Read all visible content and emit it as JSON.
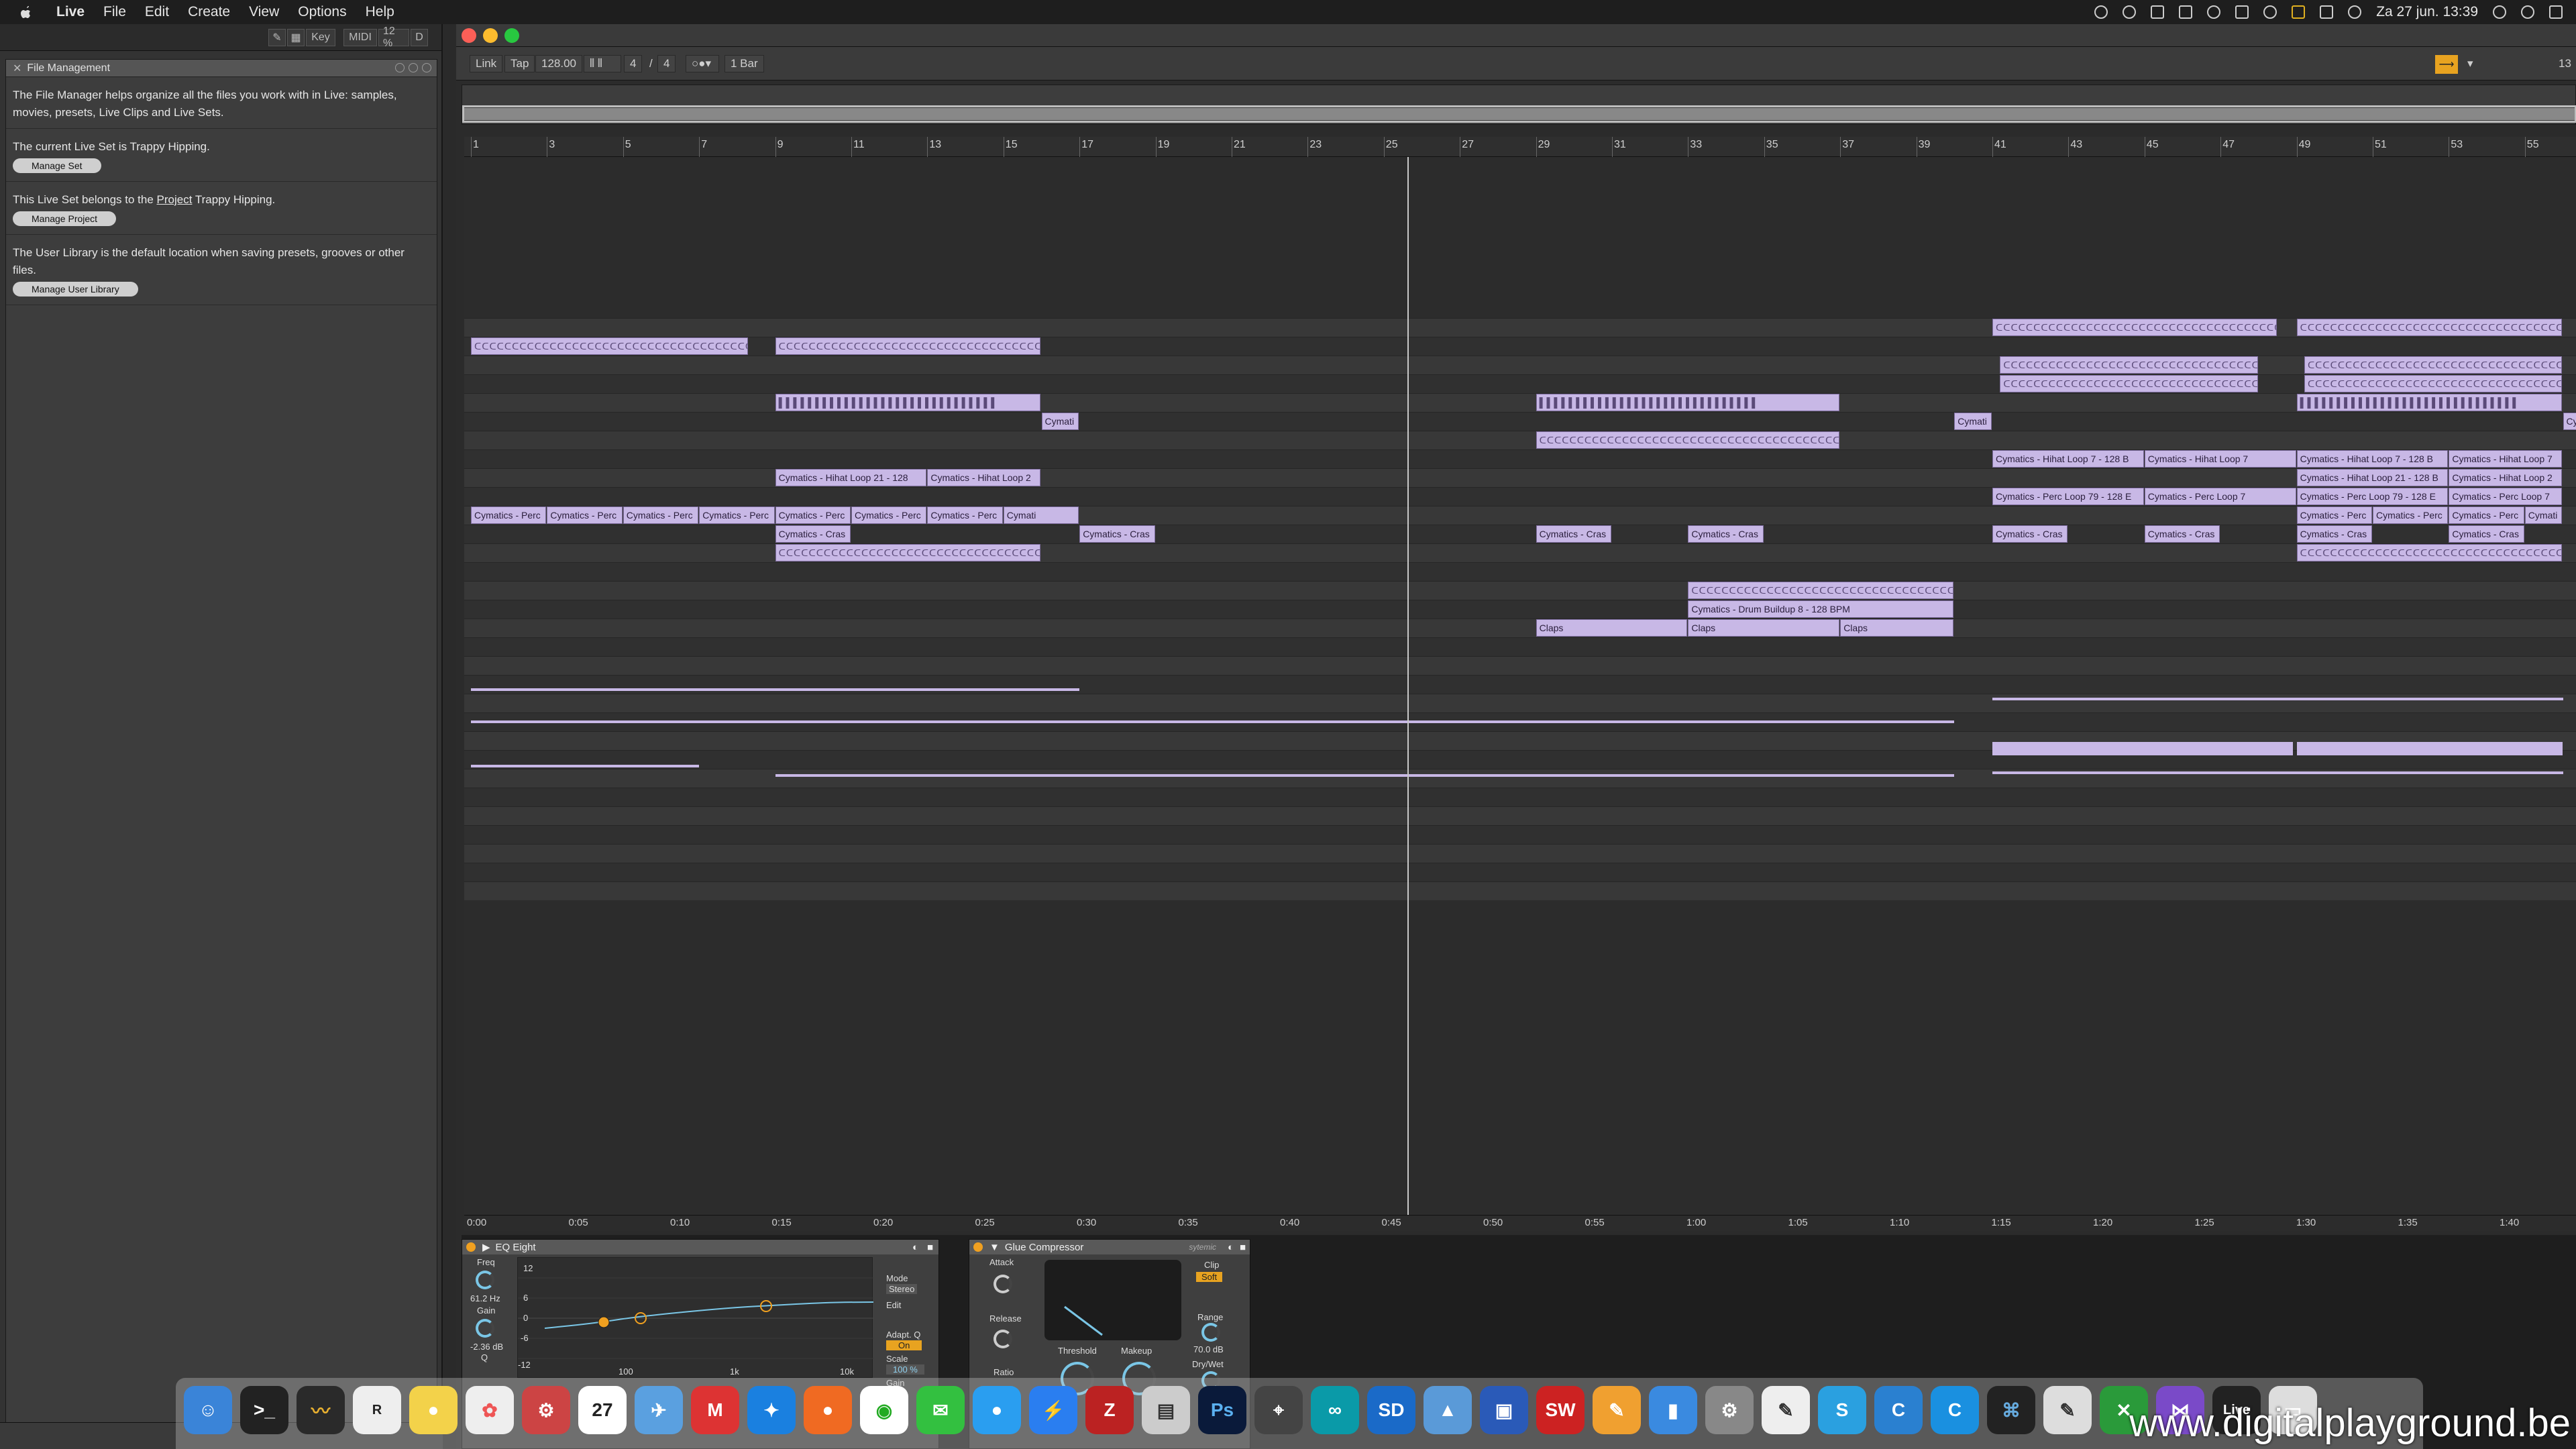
{
  "menubar": {
    "app_name": "Live",
    "items": [
      "File",
      "Edit",
      "Create",
      "View",
      "Options",
      "Help"
    ],
    "clock": "Za 27 jun.  13:39"
  },
  "browser_toolbar": {
    "key_label": "Key",
    "midi_label": "MIDI",
    "cpu_label": "12 %",
    "d_label": "D"
  },
  "info_view": {
    "title": "File Management",
    "sections": [
      {
        "text": "The File Manager helps organize all the files you work with in Live: samples, movies, presets, Live Clips and Live Sets.",
        "button": ""
      },
      {
        "text": "The current Live Set is Trappy Hipping.",
        "button": "Manage Set"
      },
      {
        "text_before": "This Live Set belongs to the ",
        "link": "Project",
        "text_after": " Trappy Hipping.",
        "button": "Manage Project"
      },
      {
        "text": "The User Library is the default location when saving presets, grooves or other files.",
        "button": "Manage User Library"
      }
    ]
  },
  "transport": {
    "link": "Link",
    "tap": "Tap",
    "tempo": "128.00",
    "meter_num": "4",
    "meter_den": "4",
    "quantize": "1 Bar",
    "right_label": "13"
  },
  "bar_ruler": [
    "1",
    "3",
    "5",
    "7",
    "9",
    "11",
    "13",
    "15",
    "17",
    "19",
    "21",
    "23",
    "25",
    "27",
    "29",
    "31",
    "33",
    "35",
    "37",
    "39",
    "41",
    "43",
    "45",
    "47",
    "49",
    "51",
    "53",
    "55"
  ],
  "time_ruler": [
    "0:00",
    "0:05",
    "0:10",
    "0:15",
    "0:20",
    "0:25",
    "0:30",
    "0:35",
    "0:40",
    "0:45",
    "0:50",
    "0:55",
    "1:00",
    "1:05",
    "1:10",
    "1:15",
    "1:20",
    "1:25",
    "1:30",
    "1:35",
    "1:40"
  ],
  "clips": {
    "hihat_21": "Cymatics - Hihat Loop 21 - 128",
    "hihat_21b": "Cymatics - Hihat Loop 2",
    "hihat_7": "Cymatics - Hihat Loop 7 - 128 B",
    "hihat_7b": "Cymatics - Hihat Loop 7",
    "hihat_7c": "Cymatics - Hihat Loop 7 - 128 B",
    "hihat_21c": "Cymatics - Hihat Loop 21 - 128 B",
    "hihat_21d": "Cymatics - Hihat Loop 2",
    "hihat_7d": "Cymatics - Hihat Loop 7",
    "perc_79": "Cymatics - Perc Loop 79 - 128 E",
    "perc_79b": "Cymatics - Perc Loop 7",
    "perc_short": "Cymatics - Perc",
    "cymati": "Cymati",
    "crash_short": "Cymatics - Cras",
    "drum_buildup": "Cymatics - Drum Buildup 8 - 128 BPM",
    "claps": "Claps",
    "cy": "Cy"
  },
  "devices": {
    "eq": {
      "name": "EQ Eight",
      "freq_label": "Freq",
      "freq_value": "61.2 Hz",
      "gain_label": "Gain",
      "gain_value": "-2.36 dB",
      "q_label": "Q",
      "mode_label": "Mode",
      "mode_value": "Stereo",
      "edit_label": "Edit",
      "adapt_label": "Adapt. Q",
      "adapt_value": "On",
      "scale_label": "Scale",
      "scale_value": "100 %",
      "gain2_label": "Gain",
      "db_ticks": [
        "12",
        "6",
        "0",
        "-6",
        "-12"
      ],
      "freq_ticks": [
        "100",
        "1k",
        "10k"
      ]
    },
    "glue": {
      "name": "Glue Compressor",
      "preset": "sytemic",
      "attack": "Attack",
      "release": "Release",
      "ratio": "Ratio",
      "threshold": "Threshold",
      "makeup": "Makeup",
      "clip": "Clip",
      "soft": "Soft",
      "range": "Range",
      "range_value": "70.0 dB",
      "drywet": "Dry/Wet"
    }
  },
  "watermark": "www.digitalplayground.be",
  "colors": {
    "clip": "#c8b8e6",
    "accent": "#e8a320",
    "knob": "#7ac6e6"
  }
}
